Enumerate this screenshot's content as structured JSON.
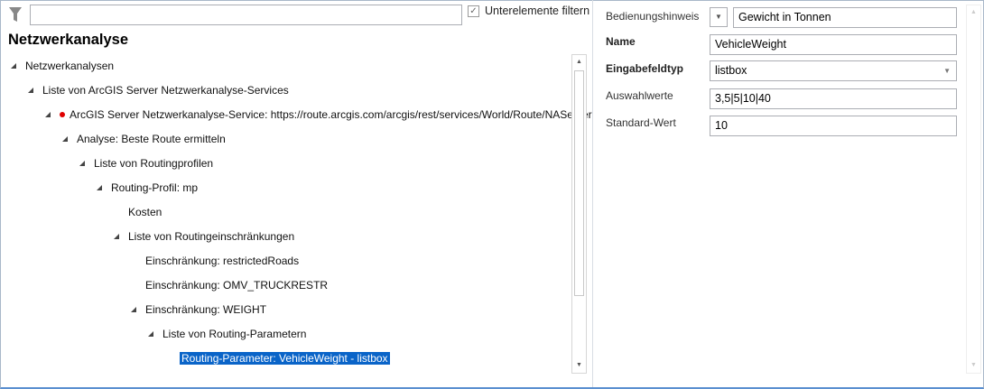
{
  "filter": {
    "value": "",
    "checkbox_label": "Unterelemente filtern",
    "checked": true
  },
  "panel_title": "Netzwerkanalyse",
  "tree": [
    {
      "label": "Netzwerkanalysen",
      "level": 0,
      "expanded": true
    },
    {
      "label": "Liste von ArcGIS Server Netzwerkanalyse-Services",
      "level": 1,
      "expanded": true
    },
    {
      "label": "ArcGIS Server Netzwerkanalyse-Service: https://route.arcgis.com/arcgis/rest/services/World/Route/NAServer",
      "level": 2,
      "expanded": true,
      "status": "error"
    },
    {
      "label": "Analyse: Beste Route ermitteln",
      "level": 3,
      "expanded": true
    },
    {
      "label": "Liste von Routingprofilen",
      "level": 4,
      "expanded": true
    },
    {
      "label": "Routing-Profil: mp",
      "level": 5,
      "expanded": true
    },
    {
      "label": "Kosten",
      "level": 6
    },
    {
      "label": "Liste von Routingeinschränkungen",
      "level": 6,
      "expanded": true
    },
    {
      "label": "Einschränkung: restrictedRoads",
      "level": 7
    },
    {
      "label": "Einschränkung: OMV_TRUCKRESTR",
      "level": 7
    },
    {
      "label": "Einschränkung: WEIGHT",
      "level": 7,
      "expanded": true
    },
    {
      "label": "Liste von Routing-Parametern",
      "level": 8,
      "expanded": true
    },
    {
      "label": "Routing-Parameter: VehicleWeight - listbox",
      "level": 9,
      "selected": true
    }
  ],
  "properties": {
    "hint_label": "Bedienungshinweis",
    "hint_value": "Gewicht in Tonnen",
    "name_label": "Name",
    "name_value": "VehicleWeight",
    "type_label": "Eingabefeldtyp",
    "type_value": "listbox",
    "values_label": "Auswahlwerte",
    "values_value": "3,5|5|10|40",
    "default_label": "Standard-Wert",
    "default_value": "10"
  },
  "colors": {
    "selection": "#0a64c8",
    "error_dot": "#e00000"
  }
}
